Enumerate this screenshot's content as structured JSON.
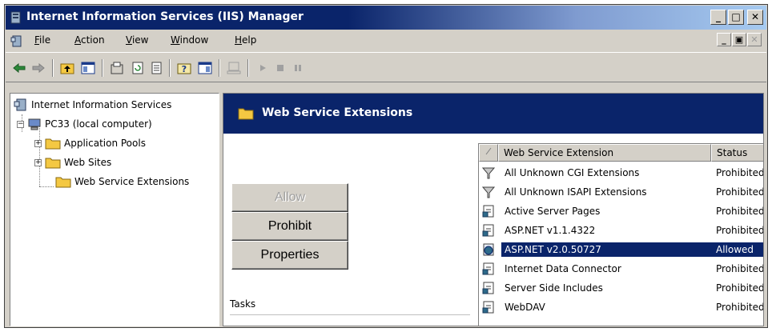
{
  "window": {
    "title": "Internet Information Services (IIS) Manager",
    "caption_buttons": {
      "minimize": "_",
      "maximize": "□",
      "close": "✕"
    }
  },
  "menubar": {
    "items": [
      {
        "label": "File",
        "mnemonic": "F"
      },
      {
        "label": "Action",
        "mnemonic": "A"
      },
      {
        "label": "View",
        "mnemonic": "V"
      },
      {
        "label": "Window",
        "mnemonic": "W"
      },
      {
        "label": "Help",
        "mnemonic": "H"
      }
    ],
    "mdi_buttons": {
      "minimize": "_",
      "restore": "▣",
      "close": "✕"
    }
  },
  "toolbar": {
    "buttons": [
      "back-arrow-icon",
      "forward-arrow-icon",
      "up-folder-icon",
      "show-hide-console-tree-icon",
      "properties-icon",
      "refresh-icon",
      "export-list-icon",
      "help-icon",
      "console-icon",
      "server-icon",
      "start-icon",
      "stop-icon",
      "pause-icon"
    ]
  },
  "tree": {
    "root": "Internet Information Services",
    "computer": "PC33 (local computer)",
    "children": [
      {
        "label": "Application Pools",
        "expander": "+"
      },
      {
        "label": "Web Sites",
        "expander": "+"
      },
      {
        "label": "Web Service Extensions"
      }
    ],
    "computer_expander": "−"
  },
  "header": {
    "title": "Web Service Extensions"
  },
  "tasks": {
    "buttons": [
      {
        "label": "Allow",
        "enabled": false
      },
      {
        "label": "Prohibit",
        "enabled": true
      },
      {
        "label": "Properties",
        "enabled": true
      }
    ],
    "label": "Tasks"
  },
  "list": {
    "columns": [
      "Web Service Extension",
      "Status"
    ],
    "rows": [
      {
        "name": "All Unknown CGI Extensions",
        "status": "Prohibited",
        "icon": "filter-icon"
      },
      {
        "name": "All Unknown ISAPI Extensions",
        "status": "Prohibited",
        "icon": "filter-icon"
      },
      {
        "name": "Active Server Pages",
        "status": "Prohibited",
        "icon": "extension-page-icon"
      },
      {
        "name": "ASP.NET v1.1.4322",
        "status": "Prohibited",
        "icon": "extension-page-icon"
      },
      {
        "name": "ASP.NET v2.0.50727",
        "status": "Allowed",
        "icon": "extension-allowed-icon",
        "selected": true
      },
      {
        "name": "Internet Data Connector",
        "status": "Prohibited",
        "icon": "extension-page-icon"
      },
      {
        "name": "Server Side Includes",
        "status": "Prohibited",
        "icon": "extension-page-icon"
      },
      {
        "name": "WebDAV",
        "status": "Prohibited",
        "icon": "extension-page-icon"
      }
    ]
  },
  "colors": {
    "title_active": "#0a246a",
    "face": "#d4d0c8",
    "selection": "#0a246a",
    "folder": "#f4c842"
  }
}
